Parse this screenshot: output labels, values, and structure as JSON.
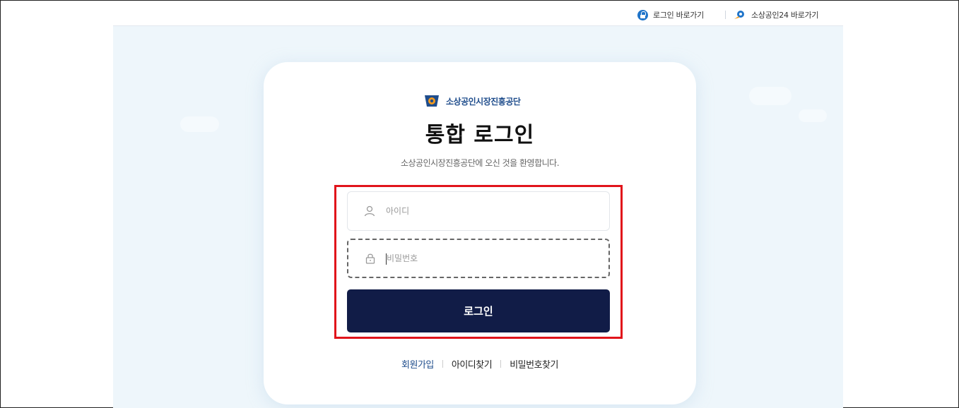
{
  "topbar": {
    "login_link": "로그인 바로가기",
    "sbiz24_link": "소상공인24 바로가기"
  },
  "logo": {
    "org_name": "소상공인시장진흥공단"
  },
  "login": {
    "title": "통합 로그인",
    "subtitle": "소상공인시장진흥공단에 오신 것을 환영합니다.",
    "id_placeholder": "아이디",
    "pw_placeholder": "비밀번호",
    "submit_label": "로그인"
  },
  "links": {
    "signup": "회원가입",
    "find_id": "아이디찾기",
    "find_pw": "비밀번호찾기"
  },
  "colors": {
    "primary_button": "#111c47",
    "highlight_border": "#e1141b",
    "accent_blue": "#1f74c9",
    "brand_orange": "#f39a1e"
  }
}
